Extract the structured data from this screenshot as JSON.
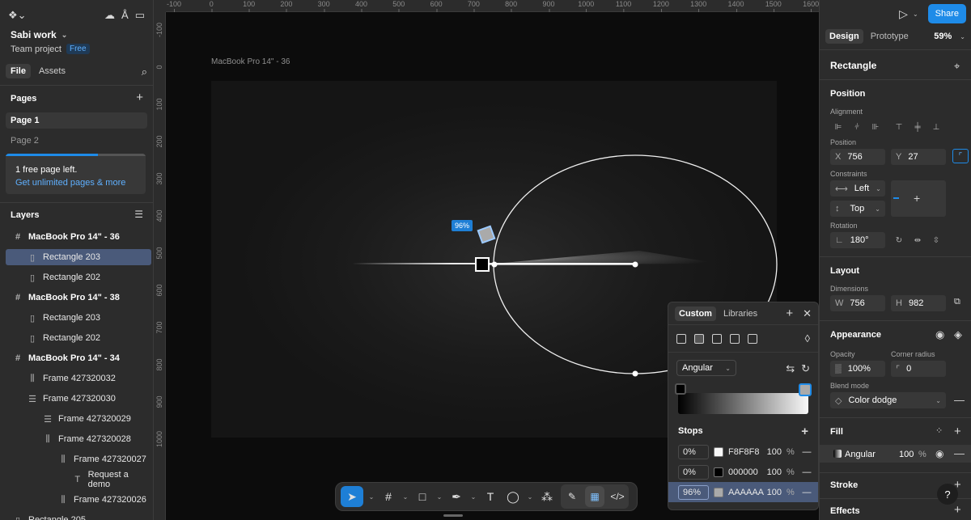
{
  "left": {
    "file_name": "Sabi work",
    "team_label": "Team project",
    "plan_badge": "Free",
    "tabs": [
      "File",
      "Assets"
    ],
    "pages_title": "Pages",
    "pages": [
      "Page 1",
      "Page 2"
    ],
    "upsell_line1": "1 free page left.",
    "upsell_line2": "Get unlimited pages & more",
    "upsell_progress": 0.66,
    "layers_title": "Layers",
    "layers": [
      {
        "label": "MacBook Pro 14\" - 36",
        "kind": "frame",
        "icon": "#",
        "indent": 0
      },
      {
        "label": "Rectangle 203",
        "kind": "rect",
        "icon": "▯",
        "indent": 1,
        "selected": true
      },
      {
        "label": "Rectangle 202",
        "kind": "rect",
        "icon": "▯",
        "indent": 1
      },
      {
        "label": "MacBook Pro 14\" - 38",
        "kind": "frame",
        "icon": "#",
        "indent": 0
      },
      {
        "label": "Rectangle 203",
        "kind": "rect",
        "icon": "▯",
        "indent": 1
      },
      {
        "label": "Rectangle 202",
        "kind": "rect",
        "icon": "▯",
        "indent": 1
      },
      {
        "label": "MacBook Pro 14\" - 34",
        "kind": "frame",
        "icon": "#",
        "indent": 0
      },
      {
        "label": "Frame 427320032",
        "kind": "autolayout",
        "icon": "⫼",
        "indent": 1
      },
      {
        "label": "Frame 427320030",
        "kind": "autolayout",
        "icon": "☰",
        "indent": 1
      },
      {
        "label": "Frame 427320029",
        "kind": "autolayout",
        "icon": "☰",
        "indent": 2
      },
      {
        "label": "Frame 427320028",
        "kind": "autolayout",
        "icon": "⫼",
        "indent": 2
      },
      {
        "label": "Frame 427320027",
        "kind": "autolayout",
        "icon": "⫼",
        "indent": 3
      },
      {
        "label": "Request a demo",
        "kind": "text",
        "icon": "T",
        "indent": 4
      },
      {
        "label": "Frame 427320026",
        "kind": "autolayout",
        "icon": "⫼",
        "indent": 3
      },
      {
        "label": "Rectangle 205",
        "kind": "rect",
        "icon": "▯",
        "indent": 0
      }
    ]
  },
  "canvas": {
    "frame_label": "MacBook Pro 14\" - 36",
    "stop_badge": "96%",
    "ruler_top": [
      "-100",
      "0",
      "100",
      "200",
      "300",
      "400",
      "500",
      "600",
      "700",
      "800",
      "900",
      "1000",
      "1100",
      "1200",
      "1300",
      "1400",
      "1500",
      "1600"
    ],
    "ruler_left": [
      "-100",
      "0",
      "100",
      "200",
      "300",
      "400",
      "500",
      "600",
      "700",
      "800",
      "900",
      "1000"
    ]
  },
  "toolbar": {
    "tools": [
      "move-tool",
      "frame-tool",
      "shape-tool",
      "pen-tool",
      "text-tool",
      "comment-tool",
      "actions-tool"
    ],
    "modes": [
      "draw-mode",
      "design-mode",
      "dev-mode"
    ]
  },
  "picker": {
    "tabs": [
      "Custom",
      "Libraries"
    ],
    "fill_type": "Angular",
    "stops_title": "Stops",
    "stops": [
      {
        "pos": "0%",
        "hex": "F8F8F8",
        "opacity": "100",
        "color": "#f8f8f8"
      },
      {
        "pos": "0%",
        "hex": "000000",
        "opacity": "100",
        "color": "#000000"
      },
      {
        "pos": "96%",
        "hex": "AAAAAA",
        "opacity": "100",
        "color": "#aaaaaa",
        "selected": true
      }
    ],
    "pct": "%"
  },
  "right": {
    "share": "Share",
    "tabs": [
      "Design",
      "Prototype"
    ],
    "zoom": "59%",
    "object_title": "Rectangle",
    "position_title": "Position",
    "alignment_label": "Alignment",
    "position_label": "Position",
    "x_key": "X",
    "x_val": "756",
    "y_key": "Y",
    "y_val": "27",
    "constraints_label": "Constraints",
    "constraint_h": "Left",
    "constraint_v": "Top",
    "rotation_label": "Rotation",
    "rotation_val": "180°",
    "layout_title": "Layout",
    "dimensions_label": "Dimensions",
    "w_key": "W",
    "w_val": "756",
    "h_key": "H",
    "h_val": "982",
    "appearance_title": "Appearance",
    "opacity_label": "Opacity",
    "opacity_val": "100%",
    "radius_label": "Corner radius",
    "radius_val": "0",
    "blend_label": "Blend mode",
    "blend_val": "Color dodge",
    "fill_title": "Fill",
    "fill_type": "Angular",
    "fill_opacity": "100",
    "fill_pct": "%",
    "stroke_title": "Stroke",
    "effects_title": "Effects",
    "help": "?"
  },
  "colors": {
    "accent": "#1e8be8",
    "selection": "#4a5a7a"
  }
}
